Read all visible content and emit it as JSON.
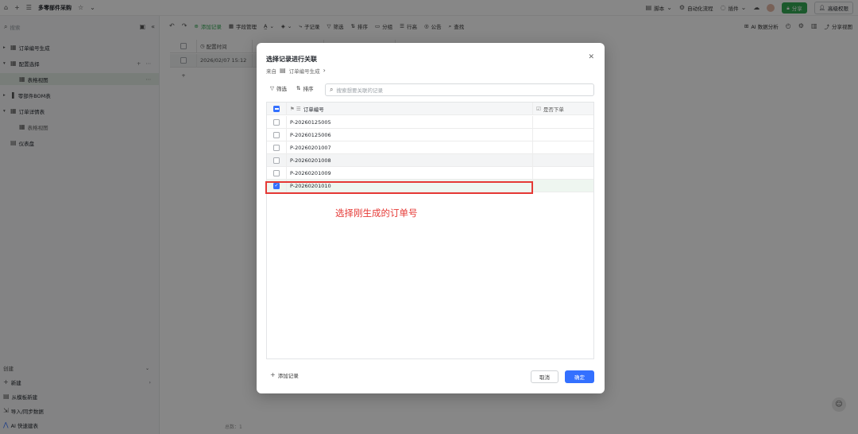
{
  "topbar": {
    "title": "多零部件采购",
    "script_label": "脚本",
    "automation_label": "自动化流程",
    "plugin_label": "插件",
    "share_label": "分享",
    "advanced_perm_label": "高级权限"
  },
  "sidebar": {
    "search_placeholder": "搜索",
    "items": [
      {
        "label": "订单编号生成"
      },
      {
        "label": "配置选择"
      },
      {
        "label": "表格视图"
      },
      {
        "label": "零部件BOM表"
      },
      {
        "label": "订单详情表"
      },
      {
        "label": "表格视图"
      },
      {
        "label": "仪表盘"
      }
    ],
    "create_heading": "创建",
    "create_items": [
      {
        "label": "新建"
      },
      {
        "label": "从模板新建"
      },
      {
        "label": "导入/同步数据"
      },
      {
        "label": "AI 快速建表"
      }
    ]
  },
  "toolbar": {
    "add_record": "添加记录",
    "field_manage": "字段管理",
    "sub_record": "子记录",
    "filter": "筛选",
    "sort": "排序",
    "group": "分组",
    "row_height": "行高",
    "announce": "公告",
    "find": "查找",
    "ai_analysis": "AI 数据分析",
    "share_view": "分享视图"
  },
  "grid": {
    "col_header": "配置时间",
    "row1_time": "2026/02/07 15:12"
  },
  "footer": {
    "count_label": "总数：1"
  },
  "modal": {
    "title": "选择记录进行关联",
    "source_prefix": "来自",
    "source_table": "订单编号生成",
    "filter_label": "筛选",
    "sort_label": "排序",
    "search_placeholder": "搜索想要关联的记录",
    "columns": {
      "order_no": "订单编号",
      "placed": "是否下单"
    },
    "rows": [
      {
        "order_no": "P-20260125005",
        "checked": false
      },
      {
        "order_no": "P-20260125006",
        "checked": false
      },
      {
        "order_no": "P-20260201007",
        "checked": false
      },
      {
        "order_no": "P-20260201008",
        "checked": false
      },
      {
        "order_no": "P-20260201009",
        "checked": false
      },
      {
        "order_no": "P-20260201010",
        "checked": true
      }
    ],
    "add_record_label": "添加记录",
    "cancel_label": "取消",
    "confirm_label": "确定"
  },
  "annotation": {
    "text": "选择刚生成的订单号"
  },
  "colors": {
    "accent_blue": "#3370ff",
    "share_green": "#34a853",
    "annotation_red": "#e53935"
  }
}
